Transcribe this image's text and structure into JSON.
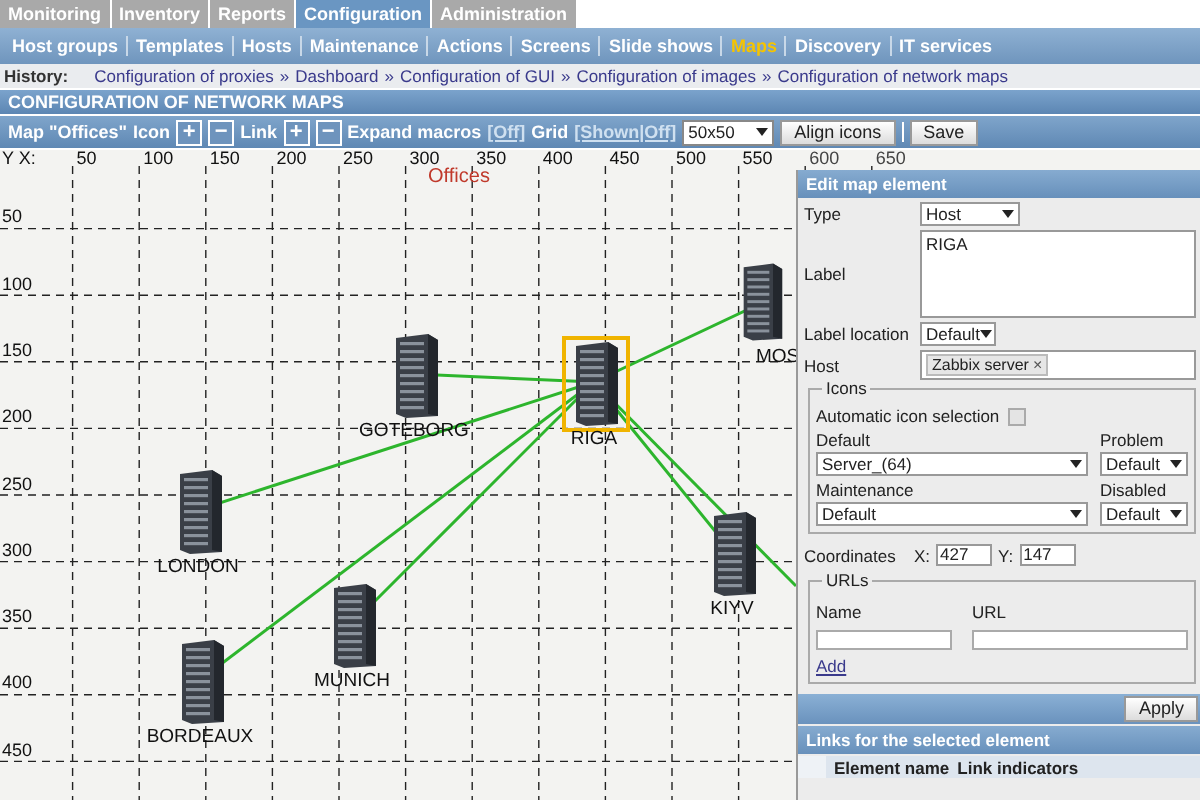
{
  "main_menu": [
    {
      "label": "Monitoring",
      "selected": false
    },
    {
      "label": "Inventory",
      "selected": false
    },
    {
      "label": "Reports",
      "selected": false
    },
    {
      "label": "Configuration",
      "selected": true
    },
    {
      "label": "Administration",
      "selected": false
    }
  ],
  "sub_menu": [
    {
      "label": "Host groups",
      "selected": false
    },
    {
      "label": "Templates",
      "selected": false
    },
    {
      "label": "Hosts",
      "selected": false
    },
    {
      "label": "Maintenance",
      "selected": false
    },
    {
      "label": "Actions",
      "selected": false
    },
    {
      "label": "Screens",
      "selected": false
    },
    {
      "label": "Slide shows",
      "selected": false
    },
    {
      "label": "Maps",
      "selected": true
    },
    {
      "label": "Discovery",
      "selected": false
    },
    {
      "label": "IT services",
      "selected": false
    }
  ],
  "history": {
    "label": "History:",
    "separator": "»",
    "items": [
      "Configuration of proxies",
      "Dashboard",
      "Configuration of GUI",
      "Configuration of images",
      "Configuration of network maps"
    ]
  },
  "page_title": "CONFIGURATION OF NETWORK MAPS",
  "toolbar": {
    "map_name": "Map \"Offices\"",
    "icon_label": "Icon",
    "add_symbol": "+",
    "remove_symbol": "−",
    "link_label": "Link",
    "expand_macros_label": "Expand macros",
    "expand_macros_value": "[Off]",
    "grid_label": "Grid",
    "grid_value": "[Shown|Off]",
    "grid_size": "50x50",
    "align_button": "Align icons",
    "save_button": "Save"
  },
  "map": {
    "title": "Offices",
    "axis_corner": "Y X:",
    "x_ticks": [
      "50",
      "100",
      "150",
      "200",
      "250",
      "300",
      "350",
      "400",
      "450",
      "500",
      "550",
      "600",
      "650"
    ],
    "y_ticks": [
      "50",
      "100",
      "150",
      "200",
      "250",
      "300",
      "350",
      "400",
      "450"
    ],
    "offscreen_link": true,
    "nodes": [
      {
        "label": "GOTEBORG",
        "selected": false
      },
      {
        "label": "RIGA",
        "selected": true
      },
      {
        "label": "LONDON",
        "selected": false
      },
      {
        "label": "MUNICH",
        "selected": false
      },
      {
        "label": "BORDEAUX",
        "selected": false
      },
      {
        "label": "KIYV",
        "selected": false
      },
      {
        "label": "MOS",
        "selected": false
      }
    ]
  },
  "edit_panel": {
    "title": "Edit map element",
    "type_label": "Type",
    "type_value": "Host",
    "label_label": "Label",
    "label_value": "RIGA",
    "label_location_label": "Label location",
    "label_location_value": "Default",
    "host_label": "Host",
    "host_chip": "Zabbix server",
    "chip_remove": "×",
    "icons": {
      "legend": "Icons",
      "automatic_label": "Automatic icon selection",
      "automatic_checked": false,
      "default_label": "Default",
      "default_value": "Server_(64)",
      "problem_label": "Problem",
      "problem_value": "Default",
      "maintenance_label": "Maintenance",
      "maintenance_value": "Default",
      "disabled_label": "Disabled",
      "disabled_value": "Default"
    },
    "coordinates_label": "Coordinates",
    "x_label": "X:",
    "x_value": "427",
    "y_label": "Y:",
    "y_value": "147",
    "urls": {
      "legend": "URLs",
      "name_header": "Name",
      "url_header": "URL",
      "add_link": "Add"
    },
    "apply_button": "Apply",
    "links_title": "Links for the selected element",
    "links_columns": [
      "Element name",
      "Link indicators"
    ]
  }
}
